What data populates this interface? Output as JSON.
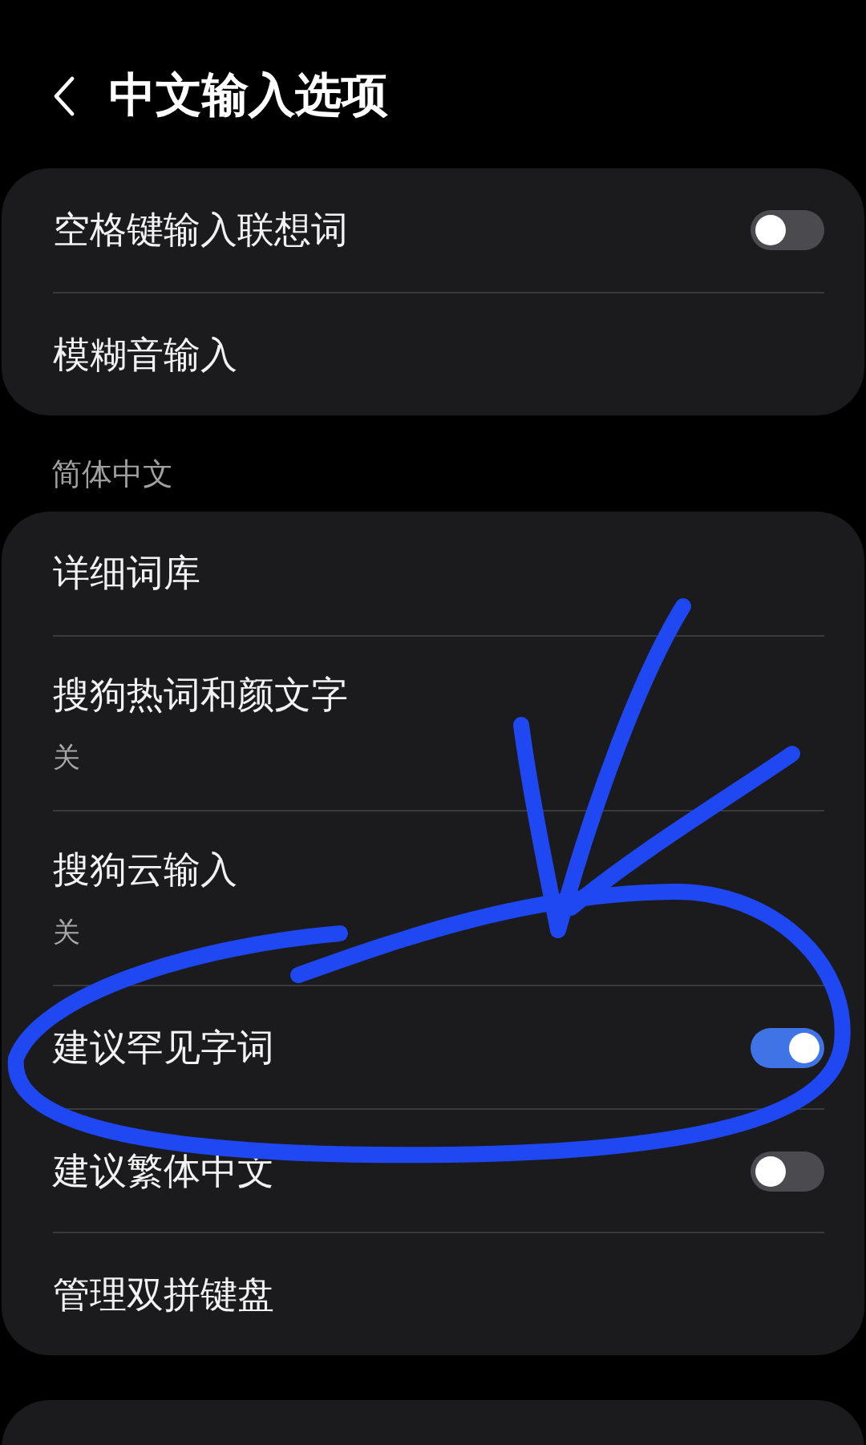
{
  "header": {
    "title": "中文输入选项"
  },
  "groups": [
    {
      "items": [
        {
          "kind": "toggle",
          "label": "空格键输入联想词",
          "on": false
        },
        {
          "kind": "nav",
          "label": "模糊音输入"
        }
      ]
    },
    {
      "header": "简体中文",
      "items": [
        {
          "kind": "nav",
          "label": "详细词库"
        },
        {
          "kind": "summary",
          "label": "搜狗热词和颜文字",
          "summary": "关"
        },
        {
          "kind": "summary",
          "label": "搜狗云输入",
          "summary": "关"
        },
        {
          "kind": "toggle",
          "label": "建议罕见字词",
          "on": true
        },
        {
          "kind": "toggle",
          "label": "建议繁体中文",
          "on": false
        },
        {
          "kind": "nav",
          "label": "管理双拼键盘"
        }
      ]
    },
    {
      "cut_off": true
    }
  ]
}
